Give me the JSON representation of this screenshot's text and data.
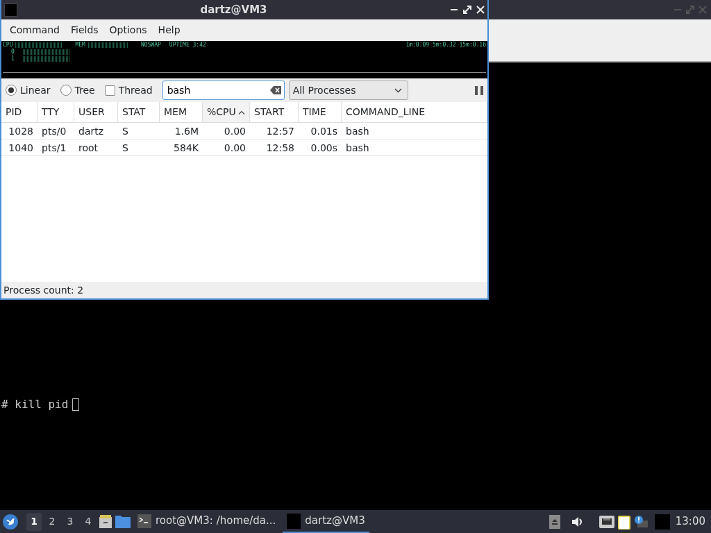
{
  "terminal": {
    "prompt": "# kill pid"
  },
  "window": {
    "title": "dartz@VM3",
    "menu": [
      "Command",
      "Fields",
      "Options",
      "Help"
    ]
  },
  "meters": {
    "cpu_label": "CPU",
    "mem_label": "MEM",
    "swap": "NOSWAP",
    "uptime": "UPTIME 3:42",
    "load": "1m:0.09 5m:0.32 15m:0.16",
    "cores": [
      "0",
      "1"
    ]
  },
  "view_modes": [
    {
      "label": "Linear",
      "selected": true
    },
    {
      "label": "Tree",
      "selected": false
    }
  ],
  "thread": {
    "label": "Thread",
    "checked": false
  },
  "search": {
    "value": "bash"
  },
  "filter": {
    "value": "All Processes"
  },
  "table": {
    "columns": [
      {
        "label": "PID",
        "numeric": true,
        "sorted": false
      },
      {
        "label": "TTY",
        "numeric": false,
        "sorted": false
      },
      {
        "label": "USER",
        "numeric": false,
        "sorted": false
      },
      {
        "label": "STAT",
        "numeric": false,
        "sorted": false
      },
      {
        "label": "MEM",
        "numeric": true,
        "sorted": false
      },
      {
        "label": "%CPU",
        "numeric": true,
        "sorted": true
      },
      {
        "label": "START",
        "numeric": true,
        "sorted": false
      },
      {
        "label": "TIME",
        "numeric": true,
        "sorted": false
      },
      {
        "label": "COMMAND_LINE",
        "numeric": false,
        "sorted": false
      }
    ],
    "rows": [
      [
        "1028",
        "pts/0",
        "dartz",
        "S",
        "1.6M",
        "0.00",
        "12:57",
        "0.01s",
        "bash"
      ],
      [
        "1040",
        "pts/1",
        "root",
        "S",
        "584K",
        "0.00",
        "12:58",
        "0.00s",
        "bash"
      ]
    ]
  },
  "status_bar": "Process count: 2",
  "taskbar": {
    "desktops": [
      {
        "label": "1",
        "selected": true
      },
      {
        "label": "2",
        "selected": false
      },
      {
        "label": "3",
        "selected": false
      },
      {
        "label": "4",
        "selected": false
      }
    ],
    "tasks": [
      {
        "label": "root@VM3: /home/da...",
        "kind": "terminal",
        "selected": false
      },
      {
        "label": "dartz@VM3",
        "kind": "app",
        "selected": true
      }
    ],
    "clock": "13:00"
  }
}
